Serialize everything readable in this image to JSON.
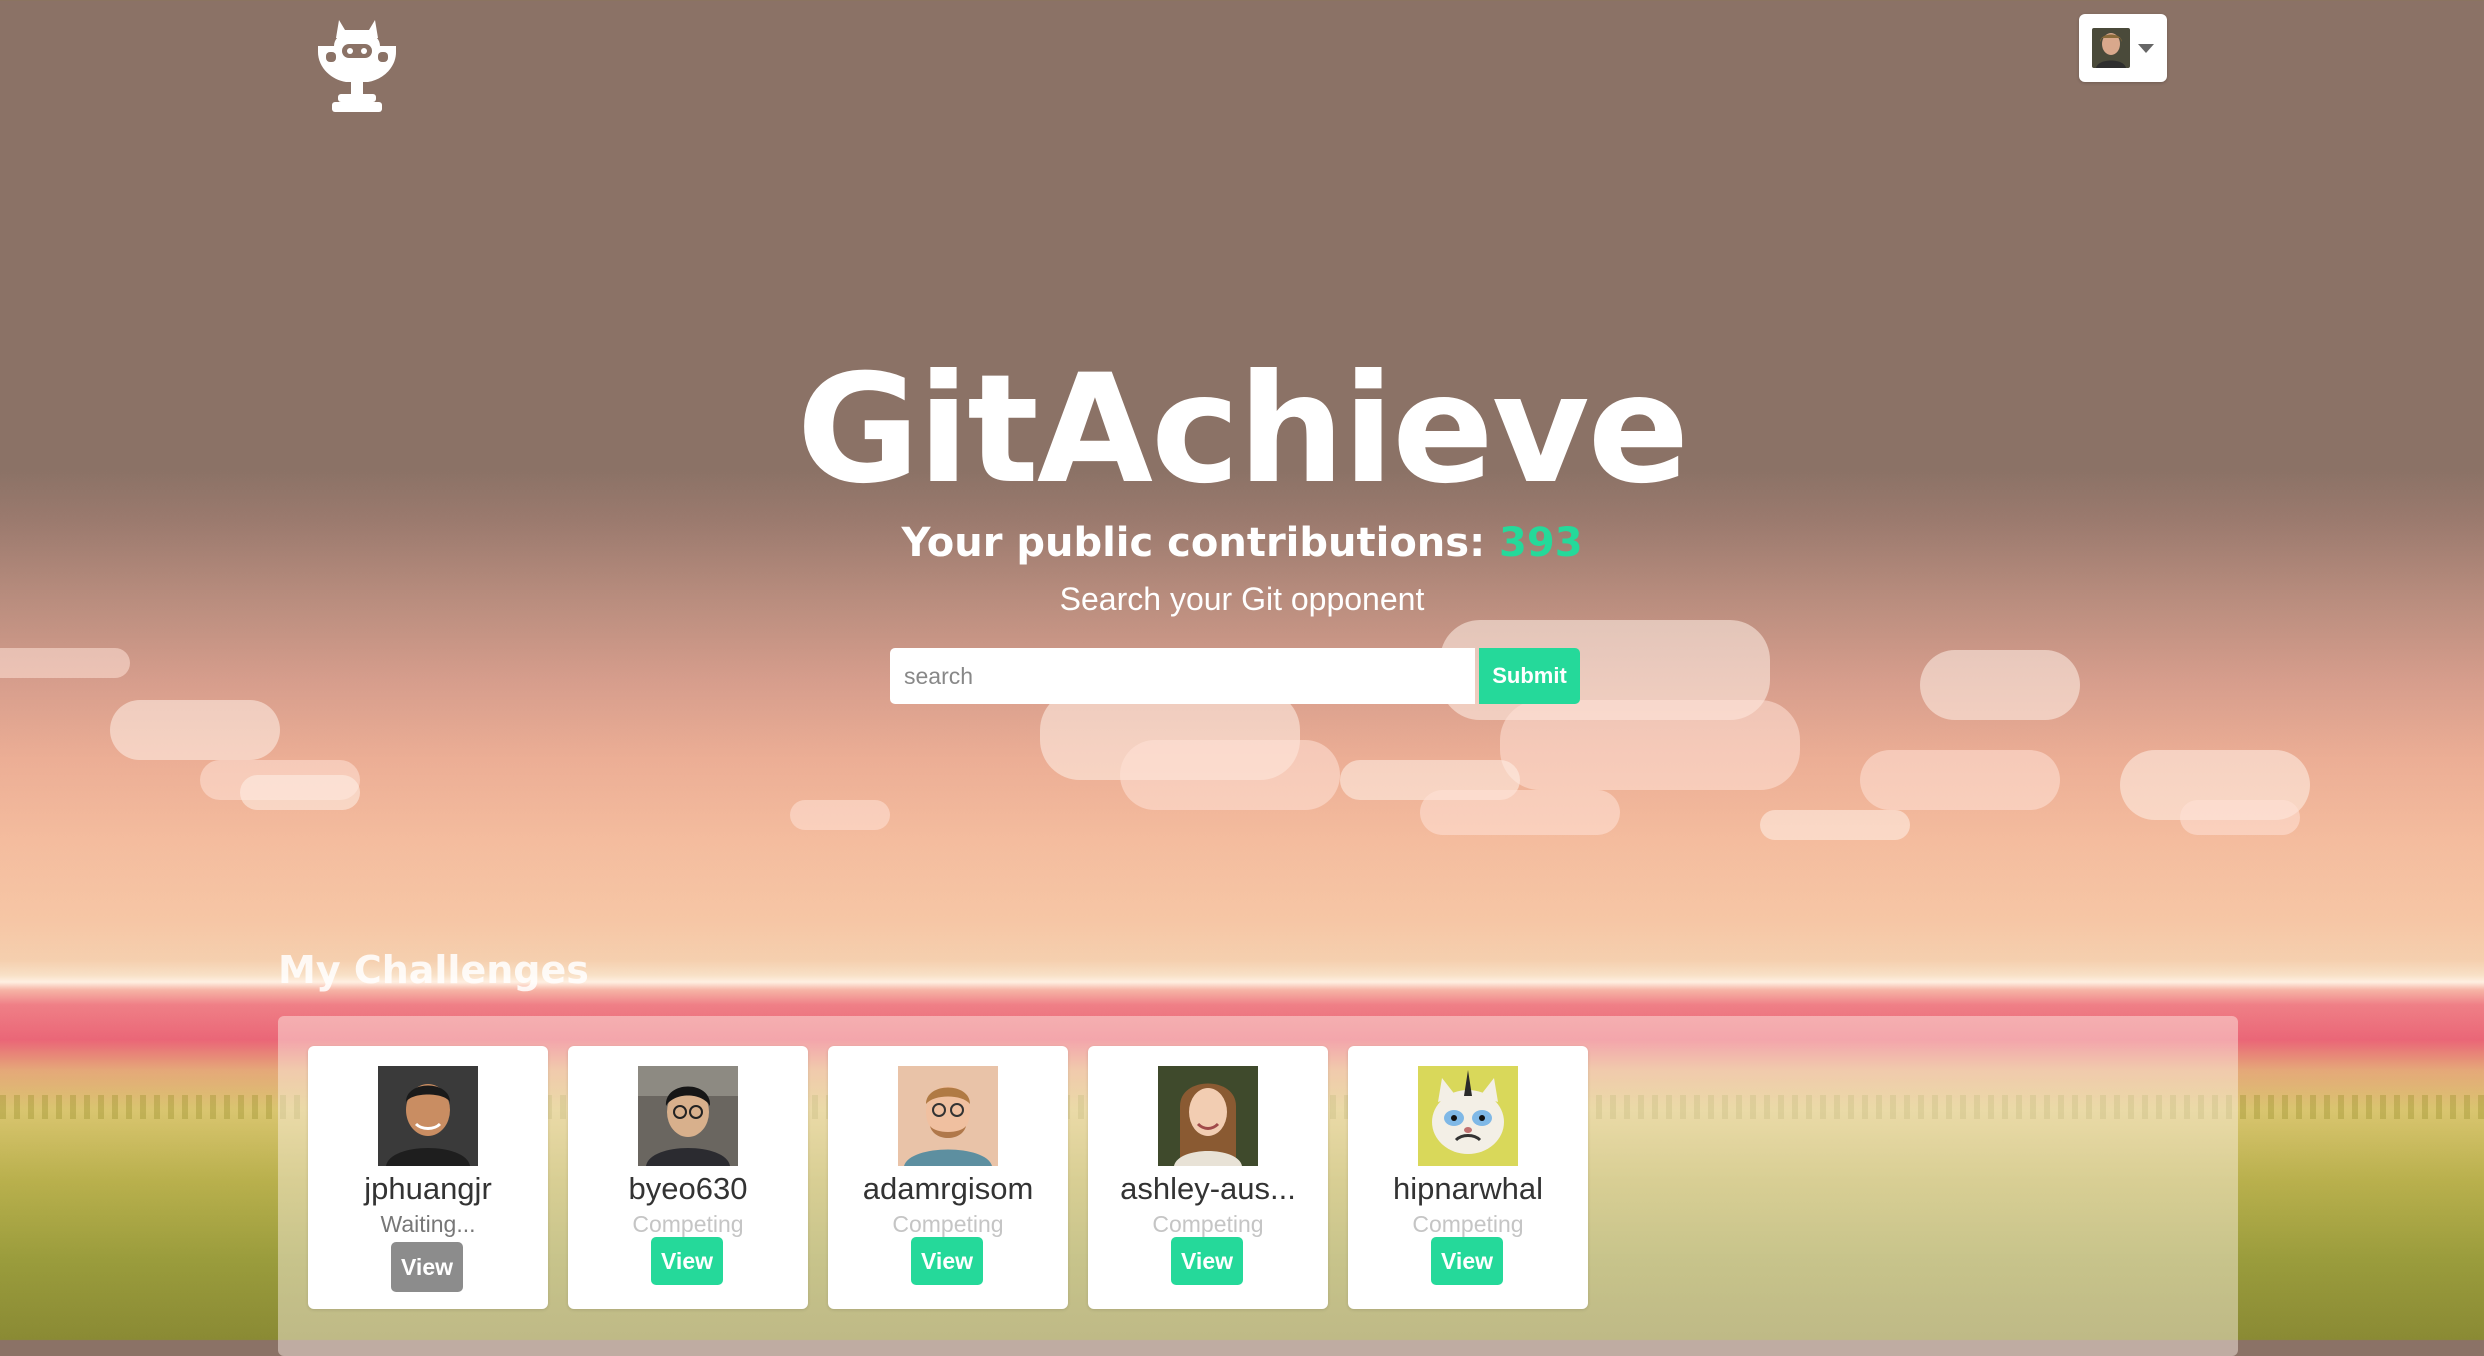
{
  "app": {
    "logo_icon": "octocat-trophy-icon"
  },
  "header": {
    "user_menu_icon": "caret-down-icon"
  },
  "hero": {
    "title": "GitAchieve",
    "contributions_label": "Your public contributions:",
    "contributions_count": "393",
    "subtitle": "Search your Git opponent"
  },
  "search": {
    "placeholder": "search",
    "value": "",
    "submit_label": "Submit"
  },
  "challenges": {
    "title": "My Challenges",
    "items": [
      {
        "username": "jphuangjr",
        "status": "Waiting...",
        "view_label": "View"
      },
      {
        "username": "byeo630",
        "status": "Competing",
        "view_label": "View"
      },
      {
        "username": "adamrgisom",
        "status": "Competing",
        "view_label": "View"
      },
      {
        "username": "ashley-aus...",
        "status": "Competing",
        "view_label": "View"
      },
      {
        "username": "hipnarwhal",
        "status": "Competing",
        "view_label": "View"
      }
    ]
  },
  "colors": {
    "accent": "#25d99a",
    "muted_button": "#8c8c8c",
    "sky_top": "#8b7266"
  }
}
